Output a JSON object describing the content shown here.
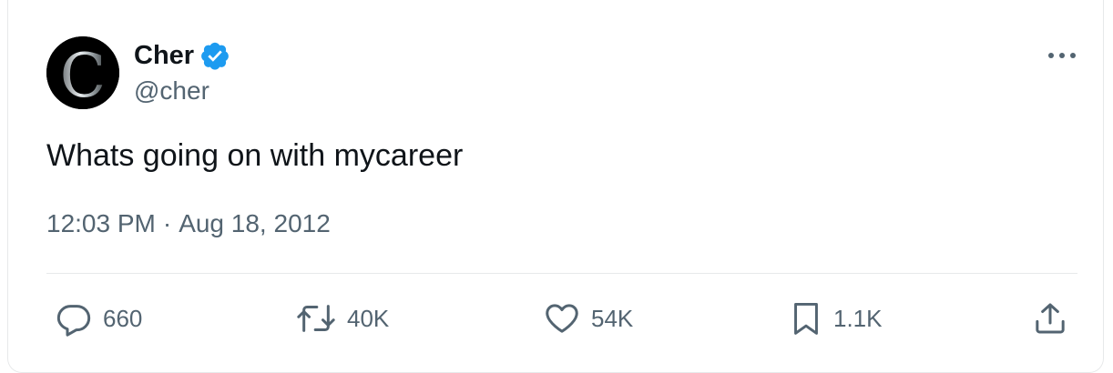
{
  "author": {
    "name": "Cher",
    "handle": "@cher",
    "verified": true,
    "avatar_letter": "C"
  },
  "tweet": {
    "text": "Whats going on with mycareer",
    "time": "12:03 PM",
    "date": "Aug 18, 2012",
    "separator": "·"
  },
  "actions": {
    "replies": "660",
    "retweets": "40K",
    "likes": "54K",
    "bookmarks": "1.1K"
  },
  "colors": {
    "verified_badge": "#1d9bf0",
    "secondary_text": "#536471",
    "primary_text": "#0f1419",
    "divider": "#e7e9ea"
  },
  "icons": [
    "more-icon",
    "verified-badge-icon",
    "reply-icon",
    "retweet-icon",
    "like-icon",
    "bookmark-icon",
    "share-icon"
  ]
}
